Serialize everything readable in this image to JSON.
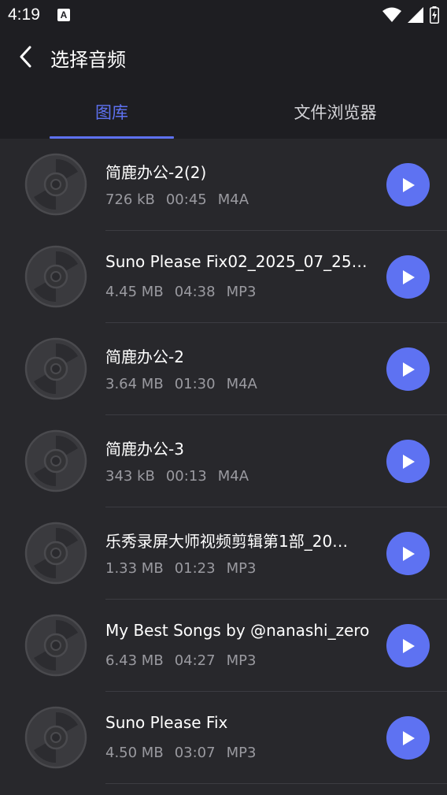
{
  "status_bar": {
    "time": "4:19",
    "notification_letter": "A",
    "icons": [
      "wifi-icon",
      "signal-icon",
      "battery-charging-icon"
    ]
  },
  "header": {
    "title": "选择音频",
    "back_icon": "chevron-left-icon"
  },
  "tabs": [
    {
      "label": "图库",
      "active": true
    },
    {
      "label": "文件浏览器",
      "active": false
    }
  ],
  "colors": {
    "accent": "#5e72f2",
    "background": "#28282c",
    "bar_background": "#1e1e22",
    "meta_text": "#9a9aa0"
  },
  "files": [
    {
      "title": "简鹿办公-2(2)",
      "size": "726 kB",
      "duration": "00:45",
      "format": "M4A"
    },
    {
      "title": "Suno Please Fix02_2025_07_25_…",
      "size": "4.45 MB",
      "duration": "04:38",
      "format": "MP3"
    },
    {
      "title": "简鹿办公-2",
      "size": "3.64 MB",
      "duration": "01:30",
      "format": "M4A"
    },
    {
      "title": "简鹿办公-3",
      "size": "343 kB",
      "duration": "00:13",
      "format": "M4A"
    },
    {
      "title": "乐秀录屏大师视频剪辑第1部_20…",
      "size": "1.33 MB",
      "duration": "01:23",
      "format": "MP3"
    },
    {
      "title": "My Best Songs by @nanashi_zero",
      "size": "6.43 MB",
      "duration": "04:27",
      "format": "MP3"
    },
    {
      "title": "Suno Please Fix",
      "size": "4.50 MB",
      "duration": "03:07",
      "format": "MP3"
    }
  ]
}
